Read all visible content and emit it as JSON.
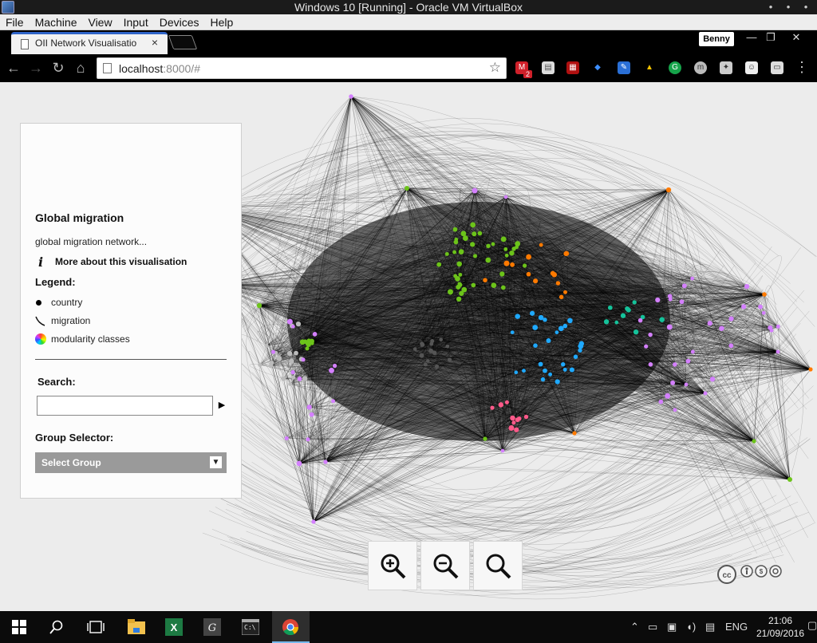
{
  "vbox": {
    "title": "Windows 10 [Running] - Oracle VM VirtualBox",
    "menu": [
      "File",
      "Machine",
      "View",
      "Input",
      "Devices",
      "Help"
    ]
  },
  "browser": {
    "tab_title": "OII Network Visualisatio",
    "profile": "Benny",
    "url_host": "localhost",
    "url_rest": ":8000/#",
    "notification_count": "2"
  },
  "panel": {
    "title": "Global migration",
    "description": "global migration network...",
    "info_label": "More about this visualisation",
    "legend_title": "Legend:",
    "legend": [
      {
        "label": "country",
        "icon": "node-dot-icon"
      },
      {
        "label": "migration",
        "icon": "edge-curve-icon"
      },
      {
        "label": "modularity classes",
        "icon": "color-wheel-icon"
      }
    ],
    "search_label": "Search:",
    "search_value": "",
    "group_label": "Group Selector:",
    "group_value": "Select Group"
  },
  "zoom_controls": [
    "zoom-in-icon",
    "zoom-out-icon",
    "zoom-reset-icon"
  ],
  "license": "cc-by-nc-sa",
  "taskbar": {
    "language": "ENG",
    "time": "21:06",
    "date": "21/09/2016"
  },
  "colors": {
    "accent_tab": "#2f64c8",
    "node_purple": "#d480ff",
    "node_green": "#6cc31a",
    "node_orange": "#ff7a00",
    "node_blue": "#1fa9ff",
    "node_teal": "#15c29a",
    "node_pink": "#ff5a8a",
    "node_gray": "#bbbbbb"
  }
}
